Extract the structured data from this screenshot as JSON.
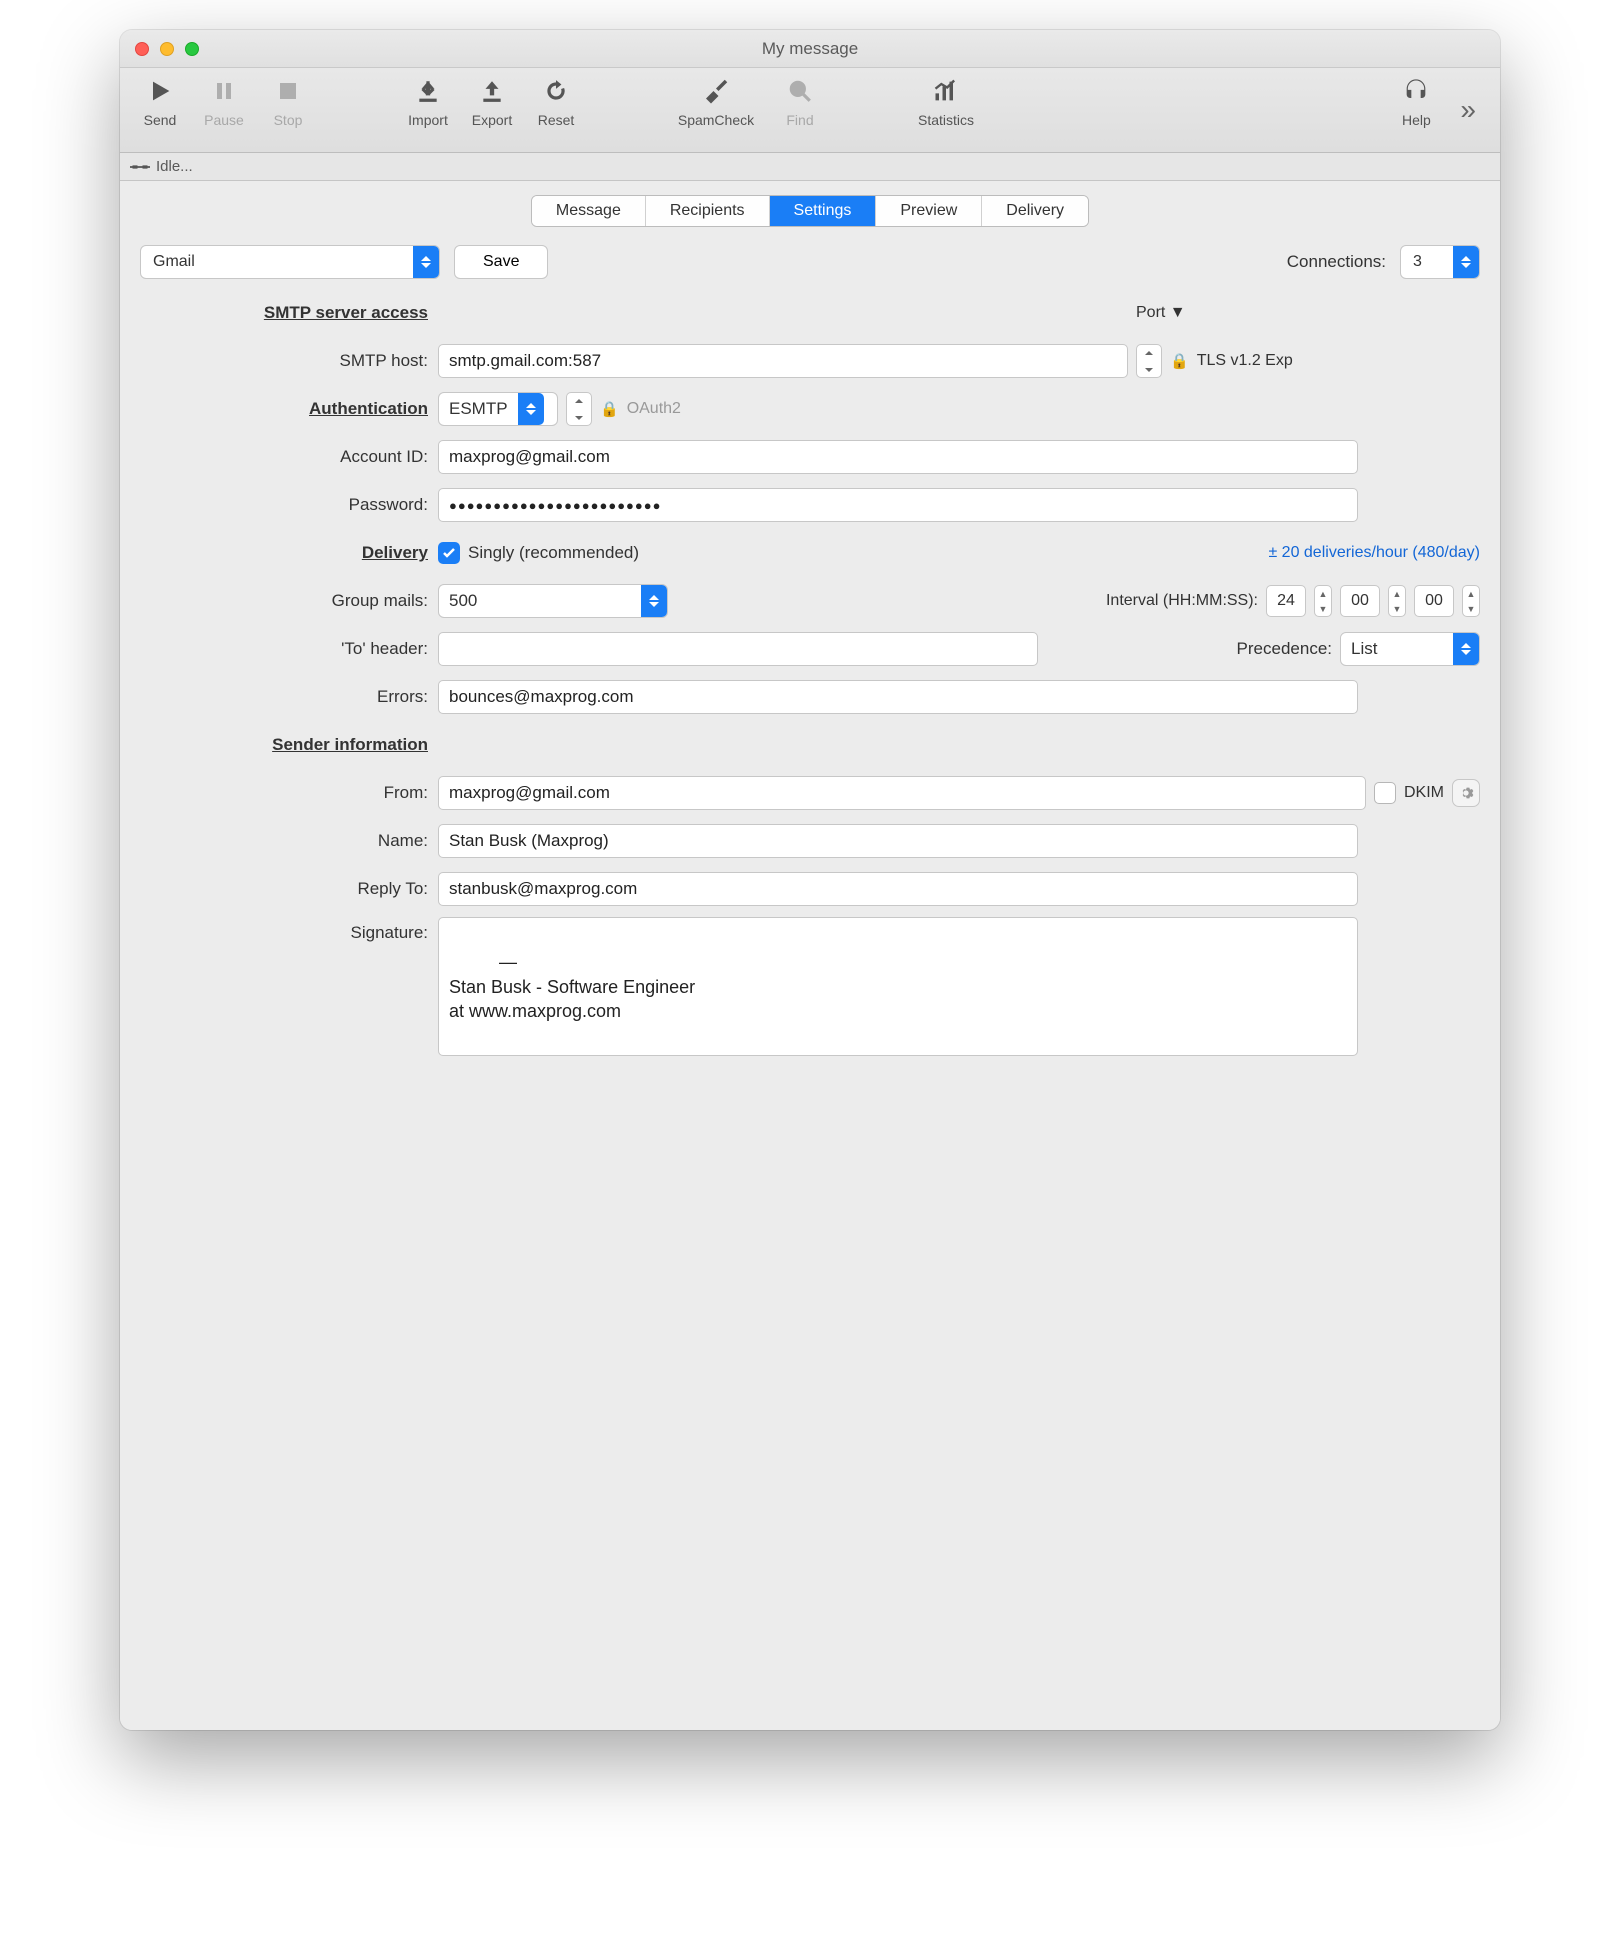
{
  "window": {
    "title": "My message"
  },
  "toolbar": {
    "send": "Send",
    "pause": "Pause",
    "stop": "Stop",
    "import": "Import",
    "export": "Export",
    "reset": "Reset",
    "spamcheck": "SpamCheck",
    "find": "Find",
    "statistics": "Statistics",
    "help": "Help"
  },
  "status": {
    "text": "Idle..."
  },
  "tabs": {
    "message": "Message",
    "recipients": "Recipients",
    "settings": "Settings",
    "preview": "Preview",
    "delivery": "Delivery"
  },
  "top": {
    "account": "Gmail",
    "save": "Save",
    "connections_label": "Connections:",
    "connections_value": "3"
  },
  "sections": {
    "smtp_header": "SMTP server access",
    "auth_header": "Authentication",
    "delivery_header": "Delivery",
    "sender_header": "Sender information"
  },
  "smtp": {
    "port_label": "Port ▼",
    "host_label": "SMTP host:",
    "host_value": "smtp.gmail.com:587",
    "tls_label": "TLS v1.2 Exp"
  },
  "auth": {
    "method": "ESMTP",
    "oauth_label": "OAuth2",
    "account_label": "Account ID:",
    "account_value": "maxprog@gmail.com",
    "password_label": "Password:",
    "password_value": "●●●●●●●●●●●●●●●●●●●●●●●●"
  },
  "delivery": {
    "singly_label": "Singly (recommended)",
    "rate_label": "± 20 deliveries/hour (480/day)",
    "group_label": "Group mails:",
    "group_value": "500",
    "interval_label": "Interval (HH:MM:SS):",
    "hh": "24",
    "mm": "00",
    "ss": "00",
    "to_header_label": "'To' header:",
    "to_header_value": "",
    "precedence_label": "Precedence:",
    "precedence_value": "List",
    "errors_label": "Errors:",
    "errors_value": "bounces@maxprog.com"
  },
  "sender": {
    "from_label": "From:",
    "from_value": "maxprog@gmail.com",
    "dkim_label": "DKIM",
    "name_label": "Name:",
    "name_value": "Stan Busk (Maxprog)",
    "reply_label": "Reply To:",
    "reply_value": "stanbusk@maxprog.com",
    "signature_label": "Signature:",
    "signature_value": "—\nStan Busk - Software Engineer\nat www.maxprog.com"
  }
}
